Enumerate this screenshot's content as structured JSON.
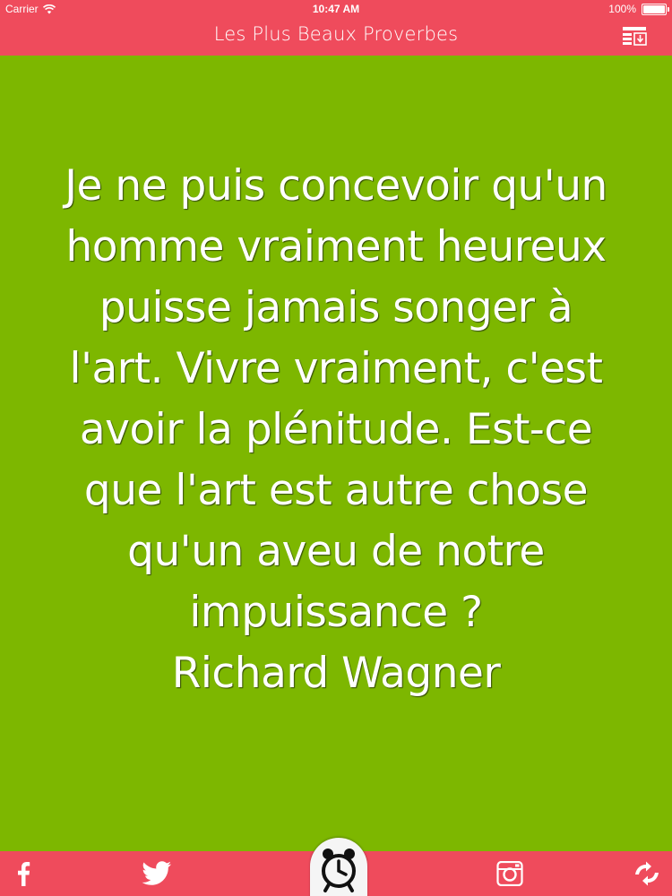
{
  "status_bar": {
    "carrier": "Carrier",
    "time": "10:47 AM",
    "battery": "100%",
    "battery_level": 1.0
  },
  "nav": {
    "title": "Les Plus Beaux Proverbes",
    "action_icon": "list-download-icon"
  },
  "quote": {
    "text": "Je ne puis concevoir qu'un\nhomme vraiment heureux\npuisse jamais songer à\nl'art. Vivre vraiment, c'est\navoir la plénitude. Est-ce\nque l'art est autre chose\nqu'un aveu de notre\nimpuissance ?",
    "author": "Richard Wagner"
  },
  "tab_bar": {
    "items": [
      {
        "icon": "facebook-icon"
      },
      {
        "icon": "twitter-icon"
      },
      {
        "icon": "alarm-clock-icon"
      },
      {
        "icon": "instagram-icon"
      },
      {
        "icon": "shuffle-refresh-icon"
      }
    ]
  },
  "colors": {
    "accent": "#ef4b5c",
    "background": "#7db700",
    "text": "#ffffff"
  }
}
